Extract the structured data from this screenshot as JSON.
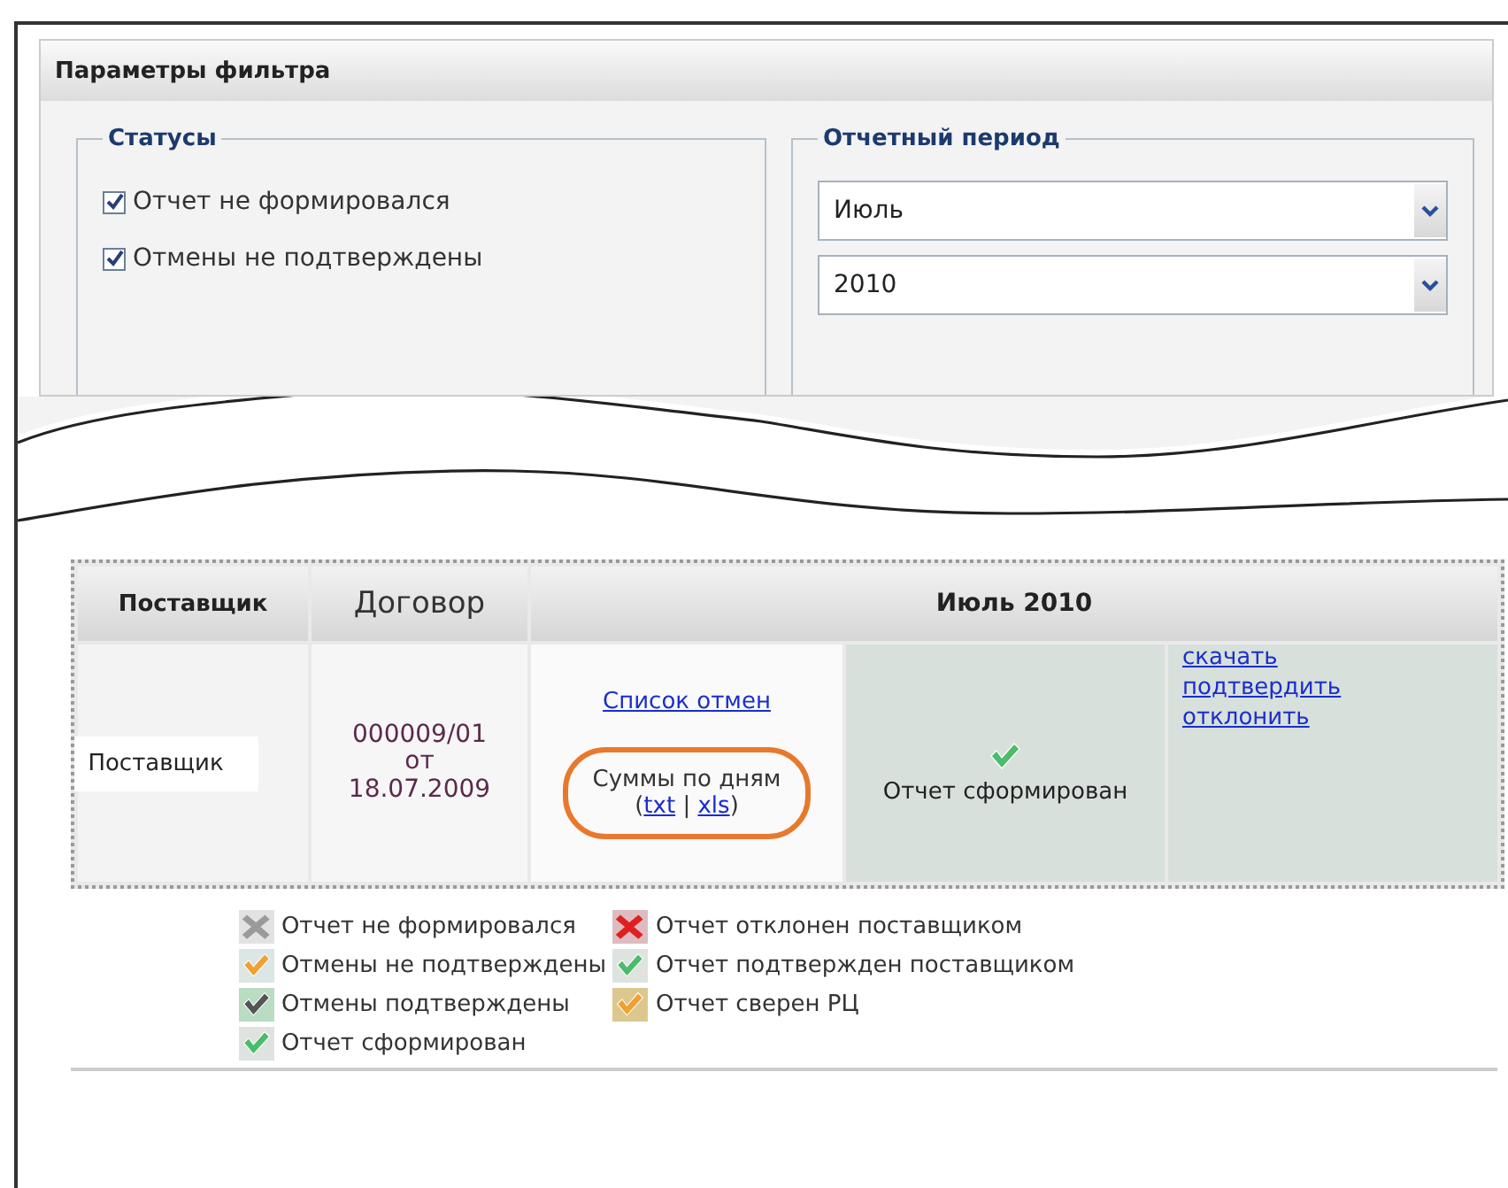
{
  "panel": {
    "title": "Параметры фильтра",
    "statuses": {
      "legend": "Статусы",
      "items": [
        {
          "label": "Отчет не формировался",
          "checked": true
        },
        {
          "label": "Отмены не подтверждены",
          "checked": true
        }
      ]
    },
    "period": {
      "legend": "Отчетный период",
      "month": "Июль",
      "year": "2010"
    }
  },
  "table": {
    "columns": [
      "Поставщик",
      "Договор",
      "Июль 2010"
    ],
    "row": {
      "supplier": "Поставщик",
      "contract": [
        "000009/01",
        "от",
        "18.07.2009"
      ],
      "cancel_link": "Список отмен",
      "sums_label": "Суммы по дням",
      "sums_formats": {
        "open": "(",
        "links": [
          "txt",
          "xls"
        ],
        "separator": "|",
        "close": ")"
      },
      "highlighted": true,
      "status": {
        "kind": "check",
        "color": "#4cbb6c",
        "label": "Отчет сформирован"
      },
      "actions": [
        "скачать",
        "подтвердить",
        "отклонить"
      ]
    }
  },
  "legend": [
    [
      {
        "kind": "cross",
        "color": "#9a9a9a",
        "label": "Отчет не формировался"
      },
      {
        "kind": "check",
        "color": "#f0a030",
        "label": "Отмены не подтверждены"
      },
      {
        "kind": "check",
        "color": "#555555",
        "label": "Отмены подтверждены"
      },
      {
        "kind": "check",
        "color": "#4cbb6c",
        "label": "Отчет сформирован"
      }
    ],
    [
      {
        "kind": "cross",
        "color": "#e02020",
        "label": "Отчет отклонен поставщиком"
      },
      {
        "kind": "check",
        "color": "#4cbb6c",
        "label": "Отчет подтвержден поставщиком"
      },
      {
        "kind": "check",
        "color": "#f0a031",
        "label": "Отчет сверен РЦ"
      }
    ]
  ]
}
